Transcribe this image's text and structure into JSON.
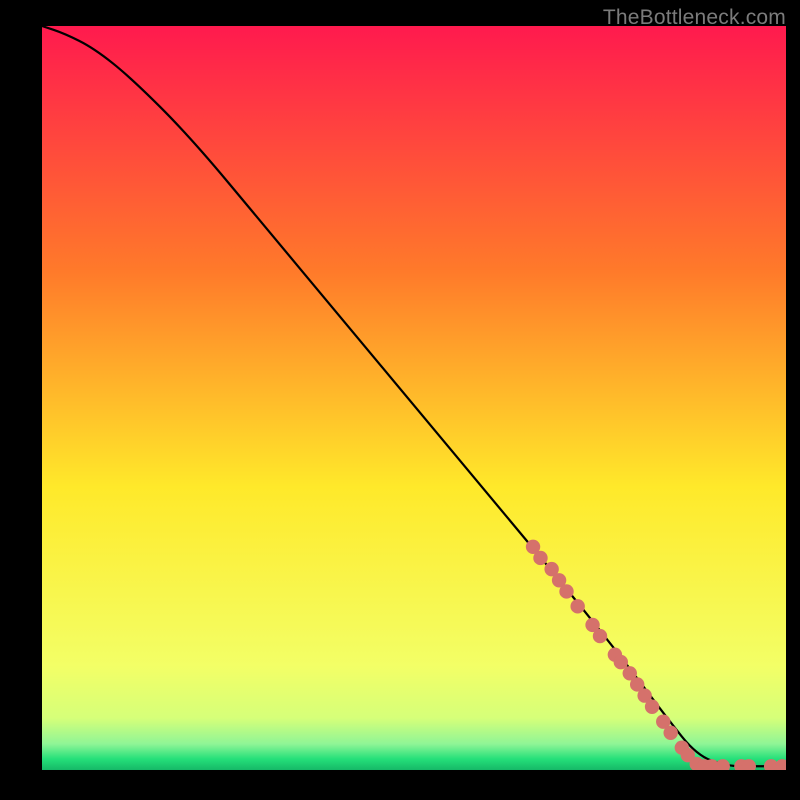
{
  "attribution": "TheBottleneck.com",
  "colors": {
    "gradient_top": "#ff1a4e",
    "gradient_mid_upper": "#ff7a2a",
    "gradient_mid": "#ffe92a",
    "gradient_lower": "#e8ff5a",
    "gradient_green": "#25e07a",
    "curve": "#000000",
    "marker": "#d5716b",
    "frame": "#000000"
  },
  "chart_data": {
    "type": "line",
    "title": "",
    "xlabel": "",
    "ylabel": "",
    "xlim": [
      0,
      100
    ],
    "ylim": [
      0,
      100
    ],
    "curve": {
      "x": [
        0,
        3,
        7,
        12,
        20,
        30,
        40,
        50,
        60,
        70,
        78,
        84,
        88,
        92,
        96,
        100
      ],
      "y": [
        100,
        99,
        97,
        93,
        85,
        73,
        61,
        49,
        37,
        25,
        15,
        7,
        2,
        0.5,
        0.5,
        0.5
      ]
    },
    "markers": {
      "x": [
        66,
        67,
        68.5,
        69.5,
        70.5,
        72,
        74,
        75,
        77,
        77.8,
        79,
        80,
        81,
        82,
        83.5,
        84.5,
        86,
        86.8,
        88,
        89,
        90,
        91.5,
        94,
        95,
        98,
        99.5
      ],
      "y": [
        30,
        28.5,
        27,
        25.5,
        24,
        22,
        19.5,
        18,
        15.5,
        14.5,
        13,
        11.5,
        10,
        8.5,
        6.5,
        5,
        3,
        2,
        0.8,
        0.5,
        0.5,
        0.5,
        0.5,
        0.5,
        0.5,
        0.5
      ]
    }
  }
}
